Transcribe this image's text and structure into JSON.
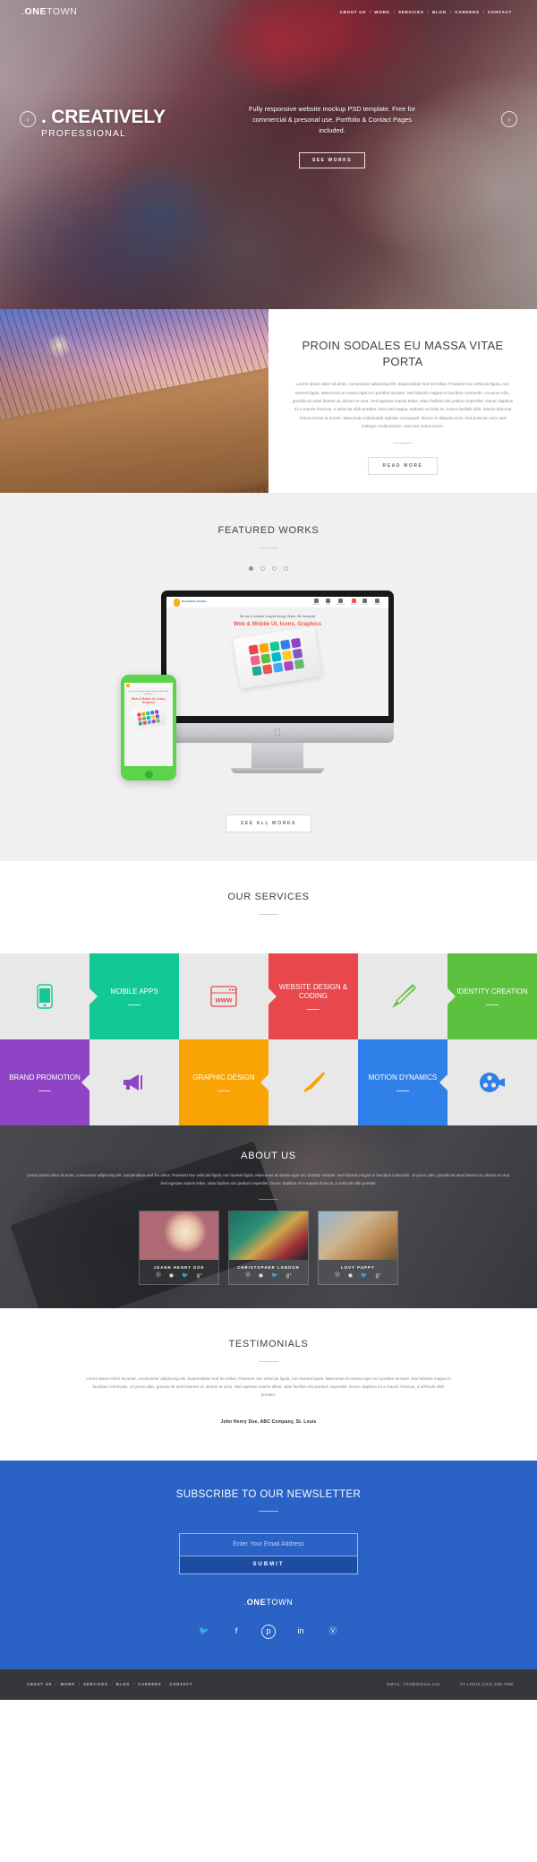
{
  "brand": {
    "dot": ".",
    "bold": "ONE",
    "light": "TOWN"
  },
  "nav": {
    "items": [
      {
        "label": "ABOUT US"
      },
      {
        "label": "WORK"
      },
      {
        "label": "SERVICES"
      },
      {
        "label": "BLOG"
      },
      {
        "label": "CAREERS"
      },
      {
        "label": "CONTACT"
      }
    ],
    "separator": "/"
  },
  "hero": {
    "title": ". CREATIVELY",
    "subtitle": "PROFESSIONAL",
    "description": "Fully responsive website mockup PSD template. Free for commercial & presonal use.  Portfolio & Contact Pages included.",
    "cta": "SEE WORKS",
    "prev_arrow": "‹",
    "next_arrow": "›"
  },
  "intro": {
    "title": "PROIN SODALES EU MASSA VITAE PORTA",
    "body": "Lorem ipsum dolor sit amet, consectetur adipiscing elit. Suspendisse sed leo tellus. Praesent nec vehicula ligula, non laoreet ligula. Maecenas at massa eget orci porttitor semper. Sed lobortis magna in faucibus commodo. Ut purus odio, gravida sit amet laoreet at, dictum et urna. Sed egestas mauris tellus, vitae facilisis nisi pretium imperdiet. Donec dapibus mi a mauris rhoncus, a vehicula nibh porttitor. Duis nisl magna, sodales vel felis eu, luctus facilisis nibh. Mauris placerat viverra lectus at ornare. Maecenas malesuada egestas consequat. Donec et aliquam eros. Sed pulvinar nunc quis tristique condimentum. Sed nec metus lorem.",
    "cta": "READ MORE"
  },
  "featured": {
    "title": "FEATURED WORKS",
    "dots": 4,
    "active_dot": 0,
    "cta": "SEE ALL WORKS",
    "mockup": {
      "logo_name": "DreamView Studios",
      "menu": [
        {
          "label": "ABOUT"
        },
        {
          "label": "WORK"
        },
        {
          "label": "SERVICES"
        },
        {
          "label": "ABOUT"
        },
        {
          "label": "BLOG"
        },
        {
          "label": "CONTACT"
        }
      ],
      "tagline": "We are a Creative Graphic Design Studio. We handcraft",
      "headline": "Web & Mobile UI, Icons, Graphics"
    }
  },
  "services": {
    "title": "OUR SERVICES",
    "items": [
      {
        "label": "MOBILE APPS",
        "color": "#12c896",
        "icon": "mobile-phone-icon",
        "icon_color": "#12c896",
        "icon_side": "left"
      },
      {
        "label": "WEBSITE DESIGN & CODING",
        "color": "#e8474c",
        "icon": "browser-www-icon",
        "icon_color": "#e8474c",
        "icon_side": "left"
      },
      {
        "label": "IDENTITY CREATION",
        "color": "#5cc13f",
        "icon": "pencil-icon",
        "icon_color": "#5cc13f",
        "icon_side": "left"
      },
      {
        "label": "BRAND PROMOTION",
        "color": "#8e44c4",
        "icon": "megaphone-icon",
        "icon_color": "#8e44c4",
        "icon_side": "right"
      },
      {
        "label": "GRAPHIC DESIGN",
        "color": "#f9a405",
        "icon": "paintbrush-icon",
        "icon_color": "#f9a405",
        "icon_side": "right"
      },
      {
        "label": "MOTION DYNAMICS",
        "color": "#2f80e8",
        "icon": "film-reel-icon",
        "icon_color": "#2f80e8",
        "icon_side": "right"
      }
    ]
  },
  "about": {
    "title": "ABOUT US",
    "body": "Lorem ipsum dolor sit amet, consectetur adipiscing elit. Suspendisse sed leo tellus. Praesent nec vehicula ligula, non laoreet ligula. Maecenas at massa eget orci porttitor semper. Sed lobortis magna in faucibus commodo. Ut purus odio, gravida sit amet laoreet at, dictum et urna. Sed egestas mauris tellus, vitae facilisis nisi pretium imperdiet. Donec dapibus mi a mauris rhoncus, a vehicula nibh porttitor.",
    "team": [
      {
        "name": "JOANN HENRY DOE",
        "socials": [
          "skype-icon",
          "dribbble-icon",
          "twitter-icon",
          "google-plus-icon"
        ]
      },
      {
        "name": "CHRISTOPHER LONDON",
        "socials": [
          "skype-icon",
          "dribbble-icon",
          "twitter-icon",
          "google-plus-icon"
        ]
      },
      {
        "name": "LOVY PUPPY",
        "socials": [
          "skype-icon",
          "dribbble-icon",
          "twitter-icon",
          "google-plus-icon"
        ]
      }
    ]
  },
  "testimonials": {
    "title": "TESTIMONIALS",
    "quote": "Lorem ipsum dolor sit amet, consectetur adipiscing elit. Suspendisse sed leo tellus. Praesent nec vehicula ligula, non laoreet ligula. Maecenas at massa eget orci porttitor semper. Sed lobortis magna in faucibus commodo. Ut purus odio, gravida sit amet laoreet at, dictum et urna. Sed egestas mauris tellus, vitae facilisis nisi pretium imperdiet. Donec dapibus mi a mauris rhoncus, a vehicula nibh porttitor.",
    "author": "John Henry Doe, ABC Company, St. Louis"
  },
  "newsletter": {
    "title": "SUBSCRIBE TO OUR NEWSLETTER",
    "email_placeholder": "Enter Your Email Address",
    "email_value": "",
    "submit": "SUBMIT",
    "socials": [
      {
        "icon": "twitter-icon"
      },
      {
        "icon": "facebook-icon"
      },
      {
        "icon": "pinterest-icon"
      },
      {
        "icon": "linkedin-icon"
      },
      {
        "icon": "skype-icon"
      }
    ]
  },
  "footer": {
    "links": [
      {
        "label": "ABOUT US"
      },
      {
        "label": "WORK"
      },
      {
        "label": "SERVICES"
      },
      {
        "label": "BLOG"
      },
      {
        "label": "CAREERS"
      },
      {
        "label": "CONTACT"
      }
    ],
    "separator": "/",
    "email": "EMAIL: info@domain.com",
    "phone": "ST.LOUIS  (123) 456-7890"
  },
  "colors": {
    "accent_blue": "#2a62c6",
    "dark": "#35373b",
    "gray_bg": "#e8e8e8"
  }
}
